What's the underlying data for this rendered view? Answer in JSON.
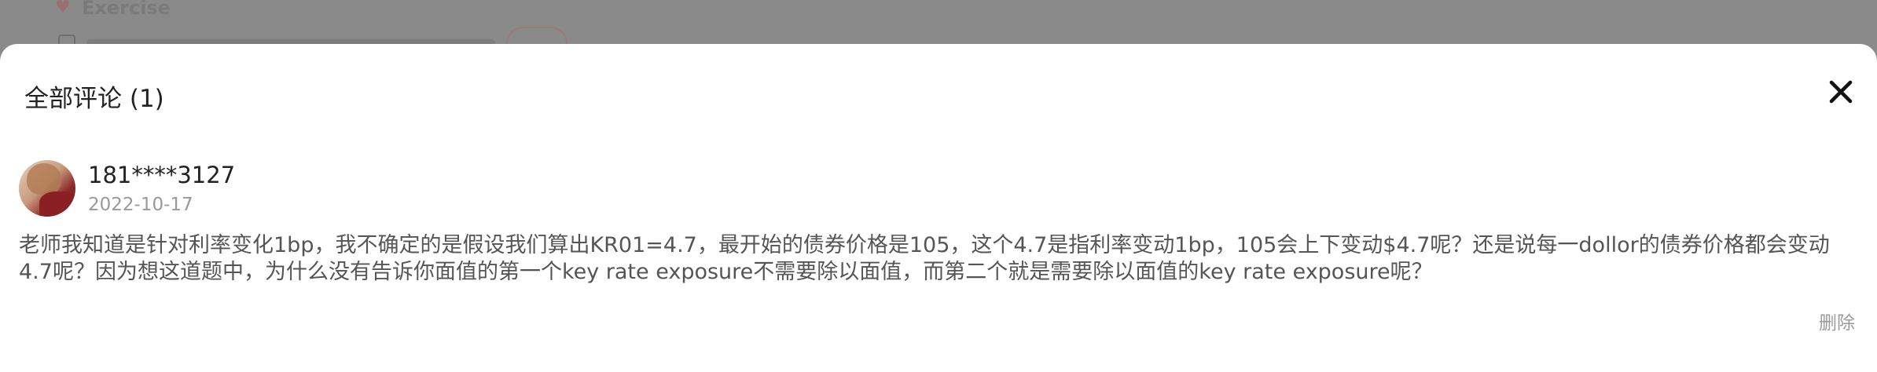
{
  "background": {
    "section_title": "Exercise"
  },
  "sheet": {
    "title": "全部评论 (1)",
    "close_icon": "close-icon"
  },
  "comment": {
    "username": "181****3127",
    "date": "2022-10-17",
    "text": "老师我知道是针对利率变化1bp，我不确定的是假设我们算出KR01=4.7，最开始的债券价格是105，这个4.7是指利率变动1bp，105会上下变动$4.7呢？还是说每一dollor的债券价格都会变动4.7呢？因为想这道题中，为什么没有告诉你面值的第一个key rate exposure不需要除以面值，而第二个就是需要除以面值的key rate exposure呢？",
    "delete_label": "删除"
  },
  "colors": {
    "overlay": "#8a8a8a",
    "sheet_bg": "#ffffff",
    "primary_text": "#222222",
    "secondary_text": "#9a9a9a",
    "body_text": "#555555"
  }
}
